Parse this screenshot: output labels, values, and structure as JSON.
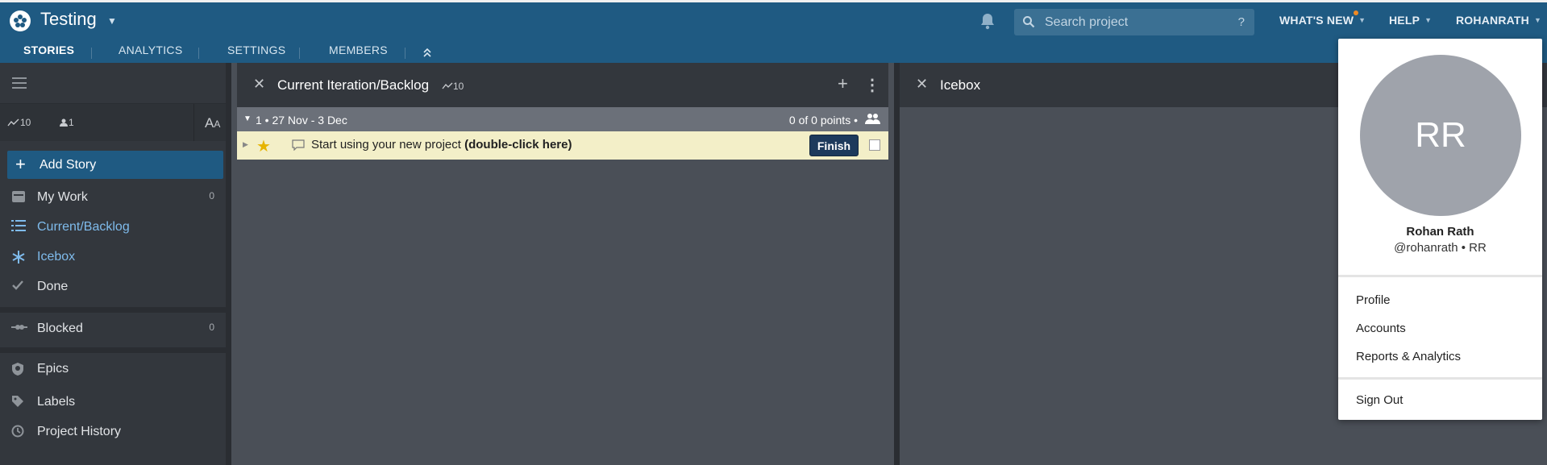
{
  "header": {
    "project_title": "Testing",
    "search_placeholder": "Search project",
    "search_help": "?",
    "whats_new": "WHAT'S NEW",
    "help": "HELP",
    "user": "ROHANRATH",
    "accent_color": "#1f5a82",
    "notification_dot_color": "#f08a24"
  },
  "tabs": [
    {
      "label": "STORIES",
      "active": true
    },
    {
      "label": "ANALYTICS",
      "active": false
    },
    {
      "label": "SETTINGS",
      "active": false
    },
    {
      "label": "MEMBERS",
      "active": false
    }
  ],
  "sidebar": {
    "velocity": "10",
    "members_count": "1",
    "text_size_label": "AA",
    "add_story": "Add Story",
    "items": [
      {
        "label": "My Work",
        "count": "0",
        "icon": "inbox-icon"
      },
      {
        "label": "Current/Backlog",
        "count": "",
        "icon": "list-icon"
      },
      {
        "label": "Icebox",
        "count": "",
        "icon": "snowflake-icon"
      },
      {
        "label": "Done",
        "count": "",
        "icon": "check-icon"
      },
      {
        "label": "Blocked",
        "count": "0",
        "icon": "blocked-icon"
      },
      {
        "label": "Epics",
        "count": "",
        "icon": "shield-icon"
      },
      {
        "label": "Labels",
        "count": "",
        "icon": "tag-icon"
      },
      {
        "label": "Project History",
        "count": "",
        "icon": "clock-icon"
      }
    ]
  },
  "backlog_panel": {
    "title": "Current Iteration/Backlog",
    "velocity": "10",
    "iteration": {
      "label": "1 • 27 Nov - 3 Dec",
      "points": "0 of 0 points •"
    },
    "story": {
      "text": "Start using your new project",
      "hint": "(double-click here)",
      "action": "Finish"
    }
  },
  "icebox_panel": {
    "title": "Icebox"
  },
  "user_menu": {
    "initials": "RR",
    "name": "Rohan Rath",
    "handle": "@rohanrath • RR",
    "items": [
      "Profile",
      "Accounts",
      "Reports & Analytics"
    ],
    "sign_out": "Sign Out"
  }
}
